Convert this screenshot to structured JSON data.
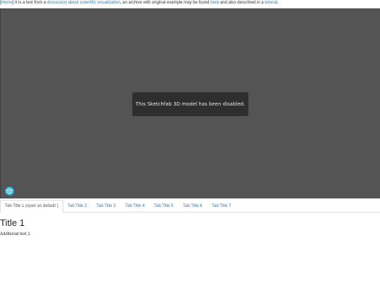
{
  "header": {
    "open_bracket": "[",
    "home_link": "Home",
    "close_bracket": "]",
    "text1": " It is a test from a ",
    "link_discussion": "discussion about scientific visualization",
    "text2": ", an archive with original example may be found ",
    "link_here": "here",
    "text3": " and also described in a ",
    "link_tutorial": "tutorial",
    "text4": "."
  },
  "viewer": {
    "disabled_message": "This Sketchfab 3D model has been disabled.",
    "logo_icon": "sketchfab-logo-icon",
    "colors": {
      "background": "#545454",
      "message_box": "#2e2e2e",
      "logo": "#1caad9"
    }
  },
  "tabs": [
    {
      "label": "Tab Title 1 (open as default )",
      "active": true
    },
    {
      "label": "Tab Title 2",
      "active": false
    },
    {
      "label": "Tab Title 3",
      "active": false
    },
    {
      "label": "Tab Title 4",
      "active": false
    },
    {
      "label": "Tab Title 5",
      "active": false
    },
    {
      "label": "Tab Title 6",
      "active": false
    },
    {
      "label": "Tab Title 7",
      "active": false
    }
  ],
  "content": {
    "title": "Title 1",
    "text": "Additional text 1"
  }
}
